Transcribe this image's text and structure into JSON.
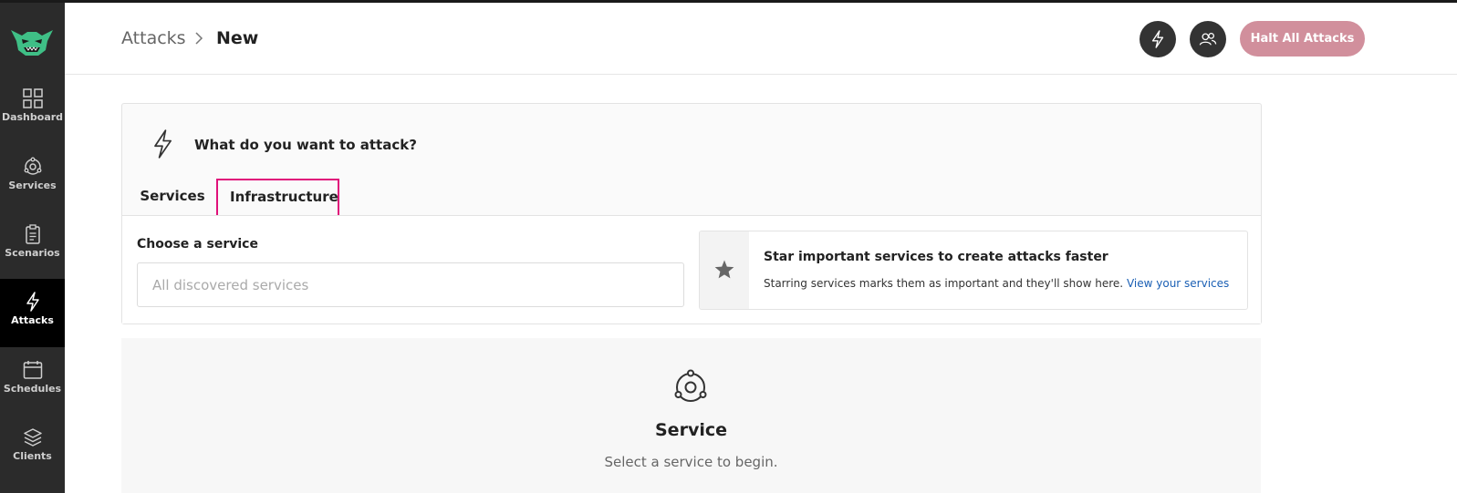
{
  "sidebar": {
    "items": [
      {
        "label": "Dashboard",
        "icon": "dashboard-grid-icon"
      },
      {
        "label": "Services",
        "icon": "services-orbit-icon"
      },
      {
        "label": "Scenarios",
        "icon": "clipboard-icon"
      },
      {
        "label": "Attacks",
        "icon": "lightning-icon",
        "active": true
      },
      {
        "label": "Schedules",
        "icon": "calendar-icon"
      },
      {
        "label": "Clients",
        "icon": "layers-icon"
      }
    ]
  },
  "header": {
    "breadcrumb_parent": "Attacks",
    "breadcrumb_current": "New",
    "halt_label": "Halt All Attacks"
  },
  "card": {
    "question": "What do you want to attack?",
    "tabs": [
      {
        "label": "Services",
        "selected": true
      },
      {
        "label": "Infrastructure",
        "selected": false
      }
    ],
    "choose_label": "Choose a service",
    "search_placeholder": "All discovered services",
    "tip": {
      "title": "Star important services to create attacks faster",
      "text": "Starring services marks them as important and they'll show here.",
      "link": "View your services"
    }
  },
  "empty_state": {
    "title": "Service",
    "subtitle": "Select a service to begin."
  },
  "colors": {
    "sidebar_bg": "#2b2b2b",
    "active_nav_bg": "#000000",
    "halt_button": "#d18f9c",
    "tab_highlight": "#e0117a",
    "link": "#1a5fb4"
  }
}
